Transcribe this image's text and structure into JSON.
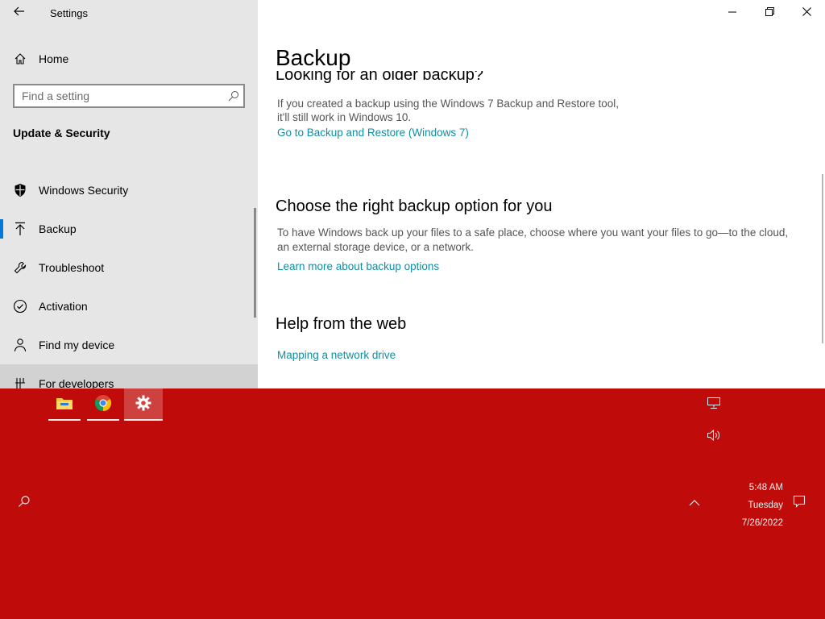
{
  "window": {
    "app_title": "Settings",
    "caption_buttons": [
      "minimize",
      "restore",
      "close"
    ]
  },
  "sidebar": {
    "home_label": "Home",
    "search_placeholder": "Find a setting",
    "section_title": "Update & Security",
    "items": [
      {
        "label": "Windows Security",
        "icon": "shield-icon"
      },
      {
        "label": "Backup",
        "icon": "backup-arrow-icon",
        "active": true
      },
      {
        "label": "Troubleshoot",
        "icon": "wrench-icon"
      },
      {
        "label": "Activation",
        "icon": "check-circle-icon"
      },
      {
        "label": "Find my device",
        "icon": "person-pin-icon"
      },
      {
        "label": "For developers",
        "icon": "developer-icon"
      }
    ]
  },
  "main": {
    "page_title": "Backup",
    "older_backup": {
      "heading": "Looking for an older backup?",
      "text_line1": "If you created a backup using the Windows 7 Backup and Restore tool,",
      "text_line2": "it'll still work in Windows 10.",
      "link": "Go to Backup and Restore (Windows 7)"
    },
    "backup_option": {
      "heading": "Choose the right backup option for you",
      "text_line1": "To have Windows back up your files to a safe place, choose where you want your files to go—to the cloud,",
      "text_line2": "an external storage device, or a network.",
      "link": "Learn more about backup options"
    },
    "help": {
      "heading": "Help from the web",
      "link": "Mapping a network drive"
    }
  },
  "taskbar": {
    "apps": [
      {
        "name": "File Explorer",
        "icon": "folder-icon"
      },
      {
        "name": "Google Chrome",
        "icon": "chrome-icon"
      },
      {
        "name": "Settings",
        "icon": "gear-icon",
        "active": true
      }
    ],
    "tray": [
      "network-icon",
      "volume-icon",
      "chevron-up-icon",
      "notifications-icon",
      "search-icon"
    ],
    "clock": {
      "time": "5:48 AM",
      "day": "Tuesday",
      "date": "7/26/2022"
    }
  },
  "colors": {
    "accent": "#0078d7",
    "link": "#0f8ea3",
    "sidebar_bg": "#e6e6e6",
    "taskbar_bg": "#bf0c0a"
  }
}
